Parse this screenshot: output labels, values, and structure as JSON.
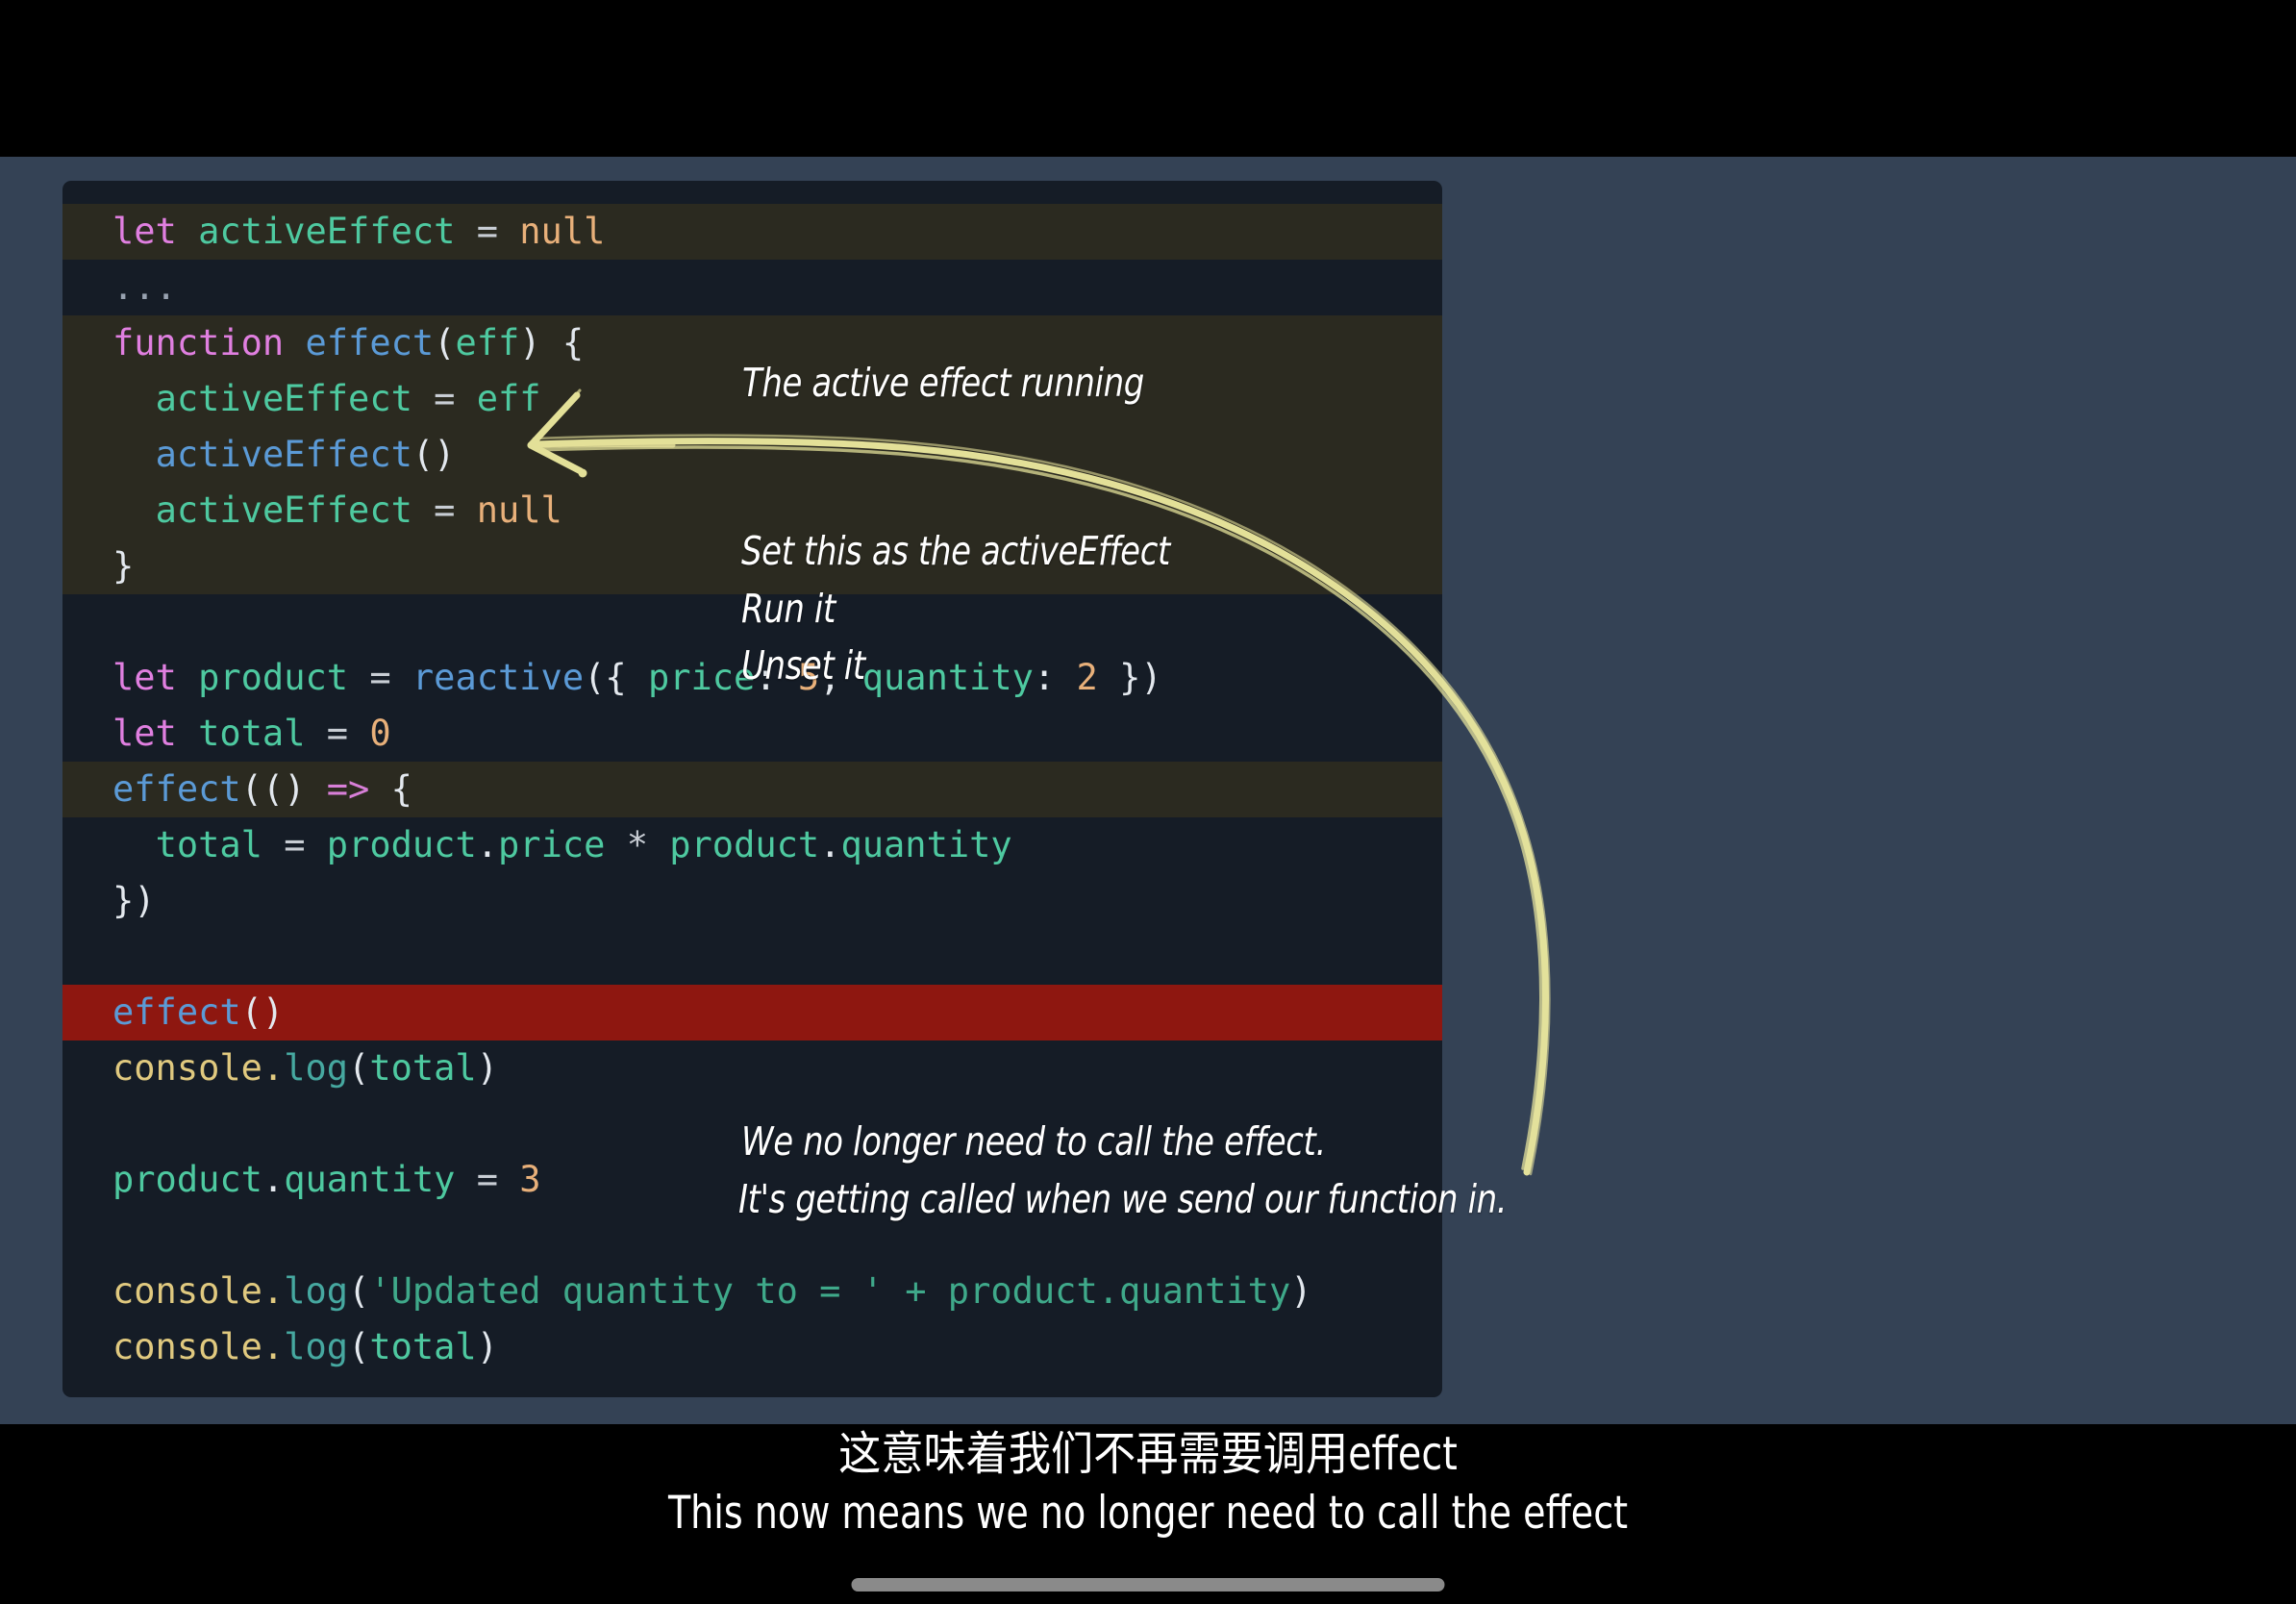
{
  "colors": {
    "stage_background": "#344255",
    "letterbox": "#000000",
    "card_background": "#151c26",
    "highlight_olive": "#2b2a20",
    "highlight_red": "#8e1710",
    "annotation_text": "#ffffff",
    "arrow_stroke": "#eeeaa0",
    "home_indicator": "#8a8a8a"
  },
  "code": {
    "language": "javascript",
    "lines": [
      {
        "id": "l1",
        "highlight": "olive",
        "text": "let activeEffect = null"
      },
      {
        "id": "l2",
        "highlight": "none",
        "text": "..."
      },
      {
        "id": "l3",
        "highlight": "olive",
        "text": "function effect(eff) {"
      },
      {
        "id": "l4",
        "highlight": "olive",
        "text": "  activeEffect = eff"
      },
      {
        "id": "l5",
        "highlight": "olive",
        "text": "  activeEffect()"
      },
      {
        "id": "l6",
        "highlight": "olive",
        "text": "  activeEffect = null"
      },
      {
        "id": "l7",
        "highlight": "olive",
        "text": "}"
      },
      {
        "id": "l8",
        "highlight": "none",
        "text": ""
      },
      {
        "id": "l9",
        "highlight": "none",
        "text": "let product = reactive({ price: 5, quantity: 2 })"
      },
      {
        "id": "l10",
        "highlight": "none",
        "text": "let total = 0"
      },
      {
        "id": "l11",
        "highlight": "olive",
        "text": "effect(() => {"
      },
      {
        "id": "l12",
        "highlight": "none",
        "text": "  total = product.price * product.quantity"
      },
      {
        "id": "l13",
        "highlight": "none",
        "text": "})"
      },
      {
        "id": "l14",
        "highlight": "none",
        "text": ""
      },
      {
        "id": "l15",
        "highlight": "red",
        "text": "effect()"
      },
      {
        "id": "l16",
        "highlight": "none",
        "text": "console.log(total)"
      },
      {
        "id": "l17",
        "highlight": "none",
        "text": ""
      },
      {
        "id": "l18",
        "highlight": "none",
        "text": "product.quantity = 3"
      },
      {
        "id": "l19",
        "highlight": "none",
        "text": ""
      },
      {
        "id": "l20",
        "highlight": "none",
        "text": "console.log('Updated quantity to = ' + product.quantity)"
      },
      {
        "id": "l21",
        "highlight": "none",
        "text": "console.log(total)"
      },
      {
        "id": "l22",
        "highlight": "none",
        "text": ""
      }
    ]
  },
  "annotations": [
    {
      "id": "a1",
      "text": "The active effect running"
    },
    {
      "id": "a2",
      "text": "Set this as the activeEffect"
    },
    {
      "id": "a3",
      "text": "Run it"
    },
    {
      "id": "a4",
      "text": "Unset it"
    },
    {
      "id": "a5",
      "text": "We no longer  need to call the effect."
    },
    {
      "id": "a6",
      "text": "It's getting called when we send our function in."
    }
  ],
  "subtitles": {
    "chinese": "这意味着我们不再需要调用effect",
    "english": "This now means we no longer need to call the effect"
  }
}
